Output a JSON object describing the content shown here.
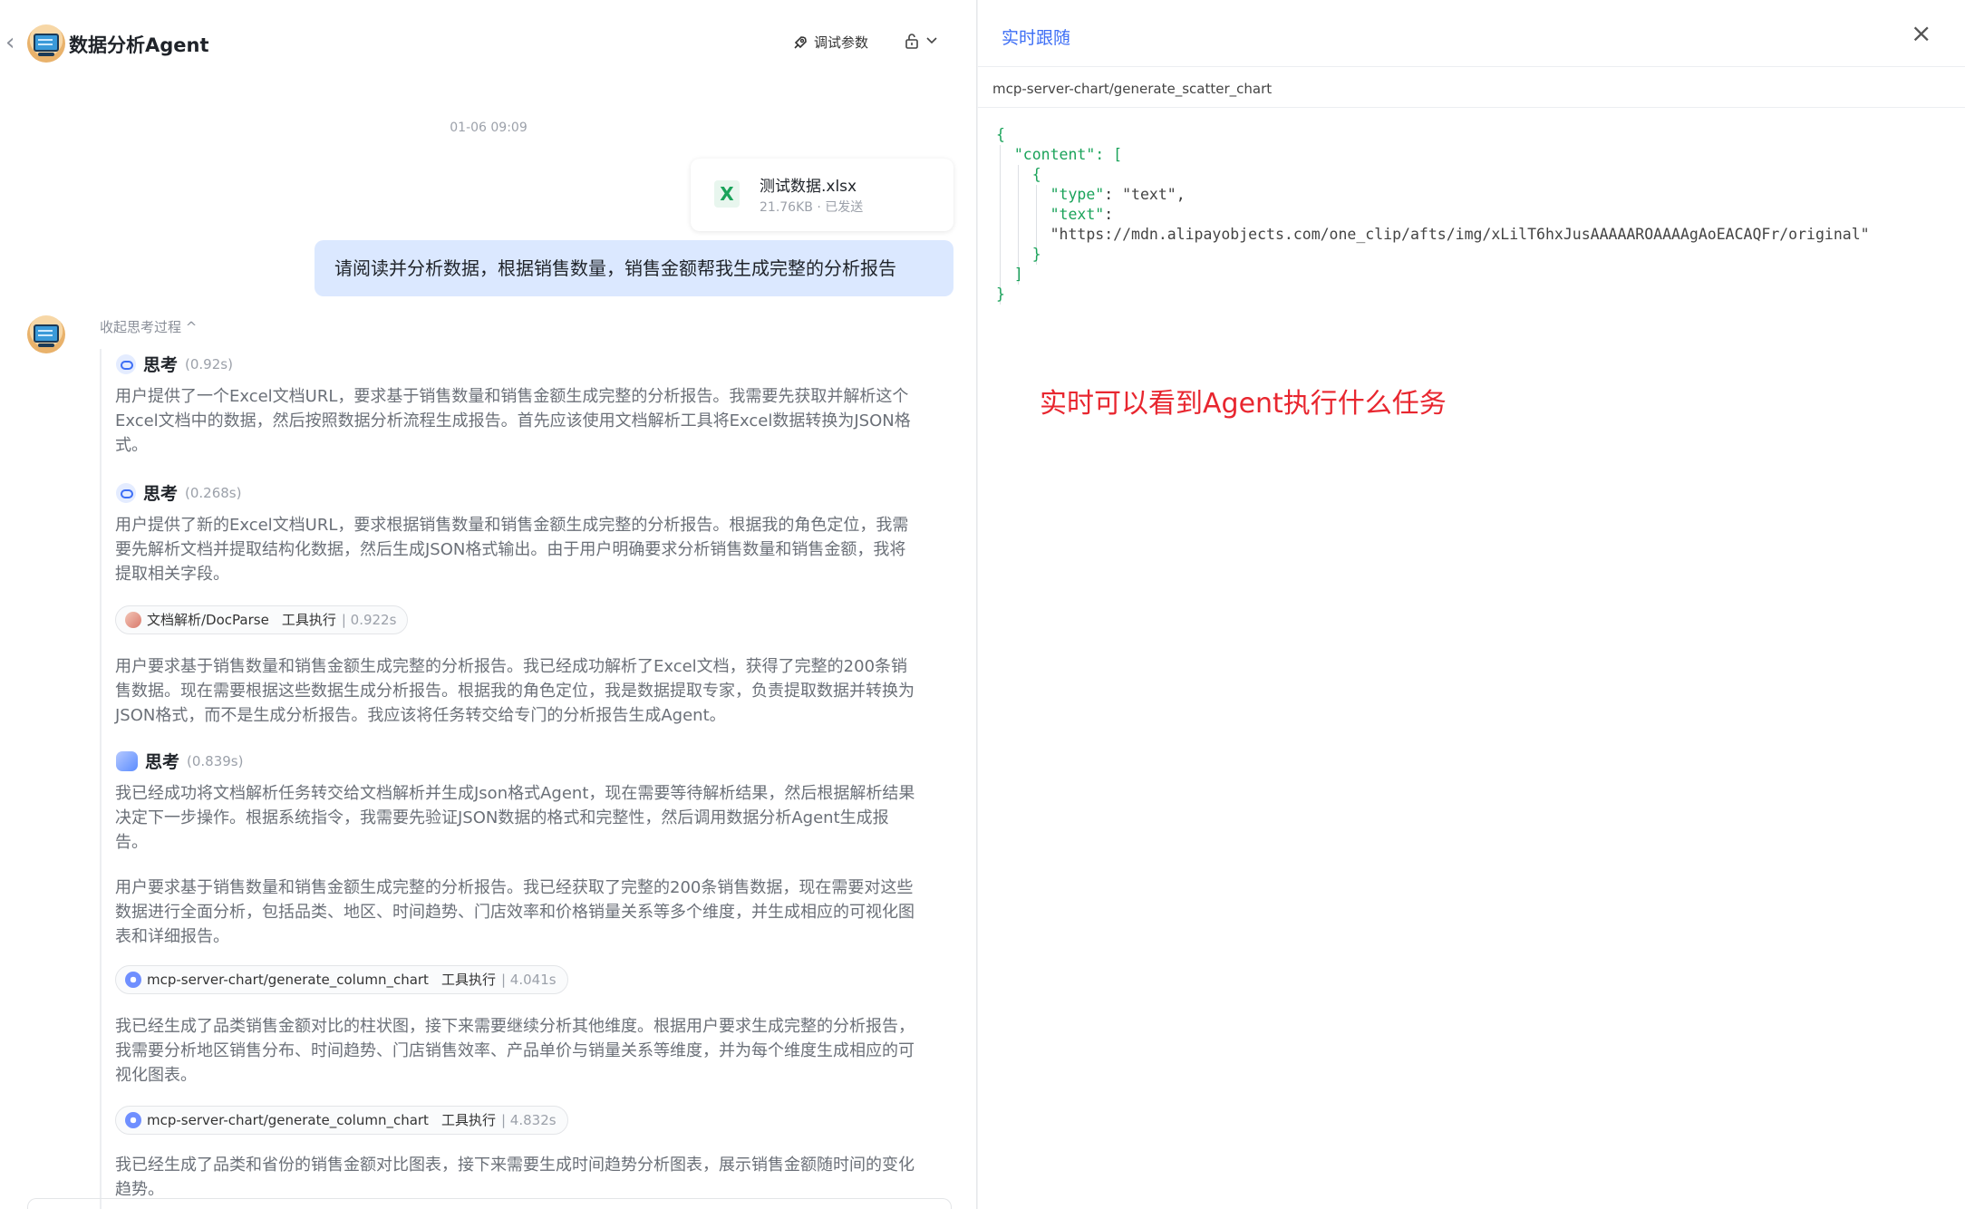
{
  "header": {
    "back_icon": "chevron-left-icon",
    "app_title": "数据分析Agent",
    "debug_label": "调试参数",
    "debug_icon": "rocket-icon",
    "lock_icon": "lock-icon"
  },
  "chat": {
    "timestamp": "01-06 09:09",
    "file": {
      "name": "测试数据.xlsx",
      "meta": "21.76KB · 已发送",
      "icon_letter": "X"
    },
    "user_message": "请阅读并分析数据，根据销售数量，销售金额帮我生成完整的分析报告",
    "collapse_label": "收起思考过程 ^",
    "think_label": "思考",
    "blocks": [
      {
        "duration": "(0.92s)",
        "text": "用户提供了一个Excel文档URL，要求基于销售数量和销售金额生成完整的分析报告。我需要先获取并解析这个Excel文档中的数据，然后按照数据分析流程生成报告。首先应该使用文档解析工具将Excel数据转换为JSON格式。"
      },
      {
        "duration": "(0.268s)",
        "text": "用户提供了新的Excel文档URL，要求根据销售数量和销售金额生成完整的分析报告。根据我的角色定位，我需要先解析文档并提取结构化数据，然后生成JSON格式输出。由于用户明确要求分析销售数量和销售金额，我将提取相关字段。"
      },
      {
        "duration": "(0.839s)",
        "text": "我已经成功将文档解析任务转交给文档解析并生成Json格式Agent，现在需要等待解析结果，然后根据解析结果决定下一步操作。根据系统指令，我需要先验证JSON数据的格式和完整性，然后调用数据分析Agent生成报告。"
      }
    ],
    "tools": [
      {
        "name": "文档解析/DocParse",
        "exec": "工具执行",
        "time": "| 0.922s"
      },
      {
        "name": "mcp-server-chart/generate_column_chart",
        "exec": "工具执行",
        "time": "| 4.041s"
      },
      {
        "name": "mcp-server-chart/generate_column_chart",
        "exec": "工具执行",
        "time": "| 4.832s"
      }
    ],
    "paragraphs": [
      "用户要求基于销售数量和销售金额生成完整的分析报告。我已经成功解析了Excel文档，获得了完整的200条销售数据。现在需要根据这些数据生成分析报告。根据我的角色定位，我是数据提取专家，负责提取数据并转换为JSON格式，而不是生成分析报告。我应该将任务转交给专门的分析报告生成Agent。",
      "用户要求基于销售数量和销售金额生成完整的分析报告。我已经获取了完整的200条销售数据，现在需要对这些数据进行全面分析，包括品类、地区、时间趋势、门店效率和价格销量关系等多个维度，并生成相应的可视化图表和详细报告。",
      "我已经生成了品类销售金额对比的柱状图，接下来需要继续分析其他维度。根据用户要求生成完整的分析报告，我需要分析地区销售分布、时间趋势、门店销售效率、产品单价与销量关系等维度，并为每个维度生成相应的可视化图表。",
      "我已经生成了品类和省份的销售金额对比图表，接下来需要生成时间趋势分析图表，展示销售金额随时间的变化趋势。"
    ]
  },
  "panel": {
    "title": "实时跟随",
    "close_icon": "close-icon",
    "tool_path": "mcp-server-chart/generate_scatter_chart",
    "json_lines": {
      "l1": "{",
      "l2_key": "\"content\"",
      "l2_rest": ": [",
      "l3": "{",
      "l4_key": "\"type\"",
      "l4_val": "\"text\"",
      "l5_key": "\"text\"",
      "l6_val": "\"https://mdn.alipayobjects.com/one_clip/afts/img/xLilT6hxJusAAAAAROAAAAgAoEACAQFr/original\"",
      "l7": "}",
      "l8": "]",
      "l9": "}"
    },
    "annotation": "实时可以看到Agent执行什么任务",
    "colors": {
      "accent": "#3d6ef5",
      "annotation": "#e8262f",
      "json_key": "#1aa35a"
    }
  }
}
